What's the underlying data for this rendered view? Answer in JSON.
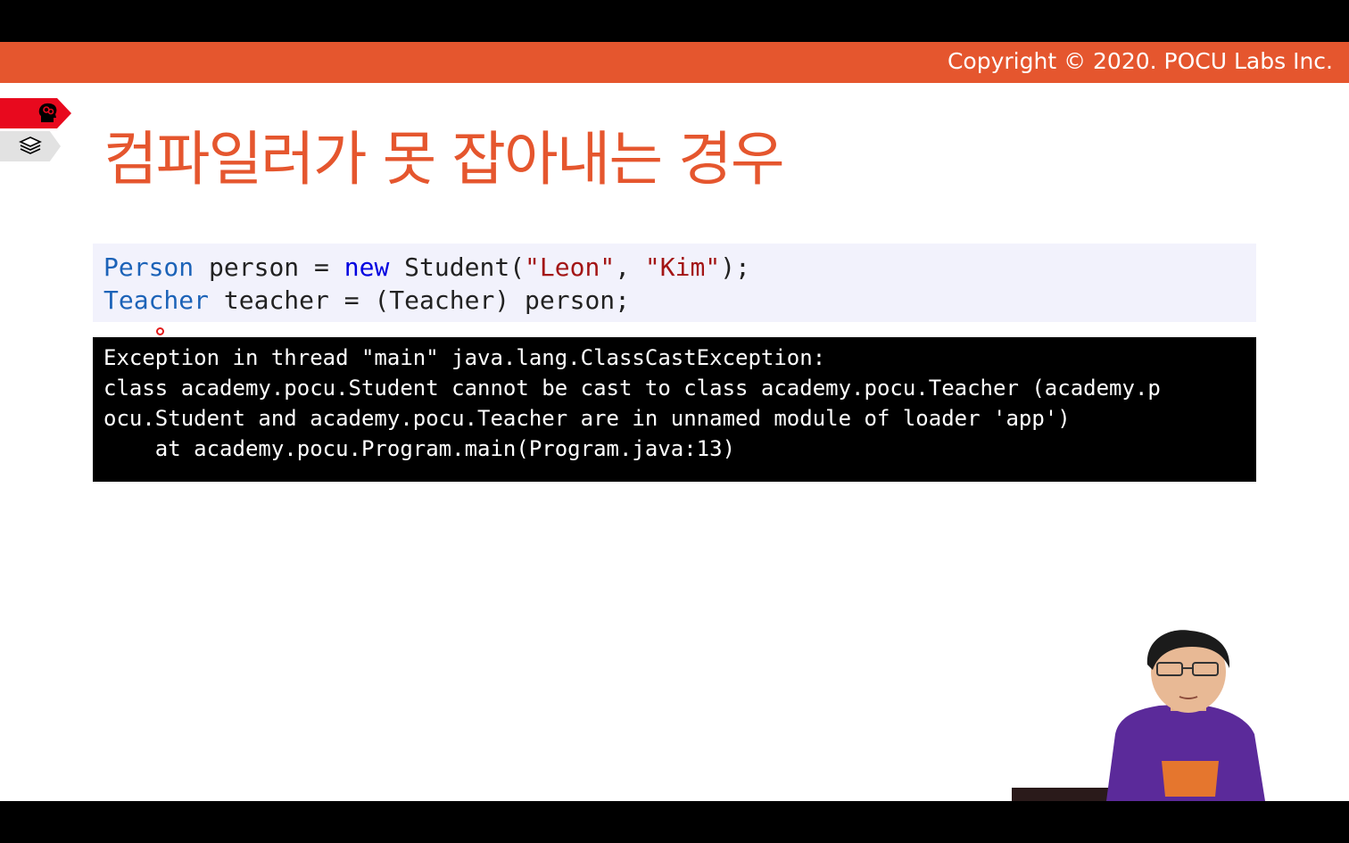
{
  "header": {
    "copyright": "Copyright © 2020. POCU Labs Inc."
  },
  "side_tabs": [
    {
      "icon": "brain-head-icon"
    },
    {
      "icon": "layers-stack-icon"
    }
  ],
  "title": "컴파일러가 못 잡아내는 경우",
  "code": {
    "line1": {
      "type": "Person",
      "var": " person = ",
      "new_kw": "new",
      "ctor": " Student(",
      "arg1": "\"Leon\"",
      "sep": ", ",
      "arg2": "\"Kim\"",
      "end": ");"
    },
    "line2": {
      "type": "Teacher",
      "rest": " teacher = (Teacher) person;"
    }
  },
  "console": {
    "lines": [
      "Exception in thread \"main\" java.lang.ClassCastException:",
      "class academy.pocu.Student cannot be cast to class academy.pocu.Teacher (academy.p",
      "ocu.Student and academy.pocu.Teacher are in unnamed module of loader 'app')",
      "    at academy.pocu.Program.main(Program.java:13)"
    ]
  },
  "colors": {
    "accent": "#e5562e",
    "tab_red": "#e8091e",
    "keyword_type": "#1c63b8",
    "keyword_new": "#0000e0",
    "string": "#a31515"
  }
}
